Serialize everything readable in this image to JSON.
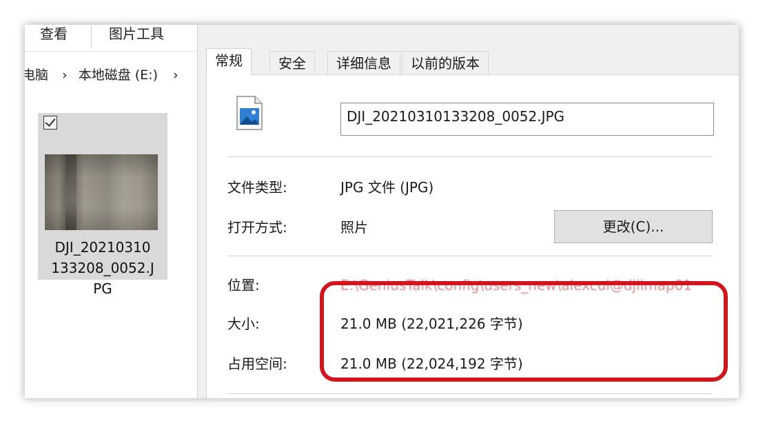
{
  "explorer": {
    "ribbon_tabs": [
      "查看",
      "图片工具"
    ],
    "breadcrumb": [
      "电脑",
      "本地磁盘 (E:)"
    ],
    "file_tile": {
      "name": "DJI_20210310133208_0052.JPG",
      "checked": true
    }
  },
  "dialog": {
    "tabs": [
      "常规",
      "安全",
      "详细信息",
      "以前的版本"
    ],
    "active_tab": "常规",
    "file_name": "DJI_20210310133208_0052.JPG",
    "file_type_label": "文件类型:",
    "file_type_value": "JPG 文件 (JPG)",
    "open_with_label": "打开方式:",
    "open_with_value": "照片",
    "change_button": "更改(C)...",
    "location_label": "位置:",
    "location_value": "E:\\GeniusTalk\\config\\users_new\\alexcui@djiimap01",
    "size_label": "大小:",
    "size_value": "21.0 MB (22,021,226 字节)",
    "disk_size_label": "占用空间:",
    "disk_size_value": "21.0 MB (22,024,192 字节)"
  },
  "colors": {
    "highlight": "#d2141c",
    "dialog_bg": "#f0f0f0",
    "panel_bg": "#ffffff",
    "button_bg": "#e1e1e1"
  },
  "icons": {
    "file": "image-file-icon",
    "checkbox": "checkbox-checked-icon",
    "breadcrumb_separator": "chevron-right-icon"
  }
}
